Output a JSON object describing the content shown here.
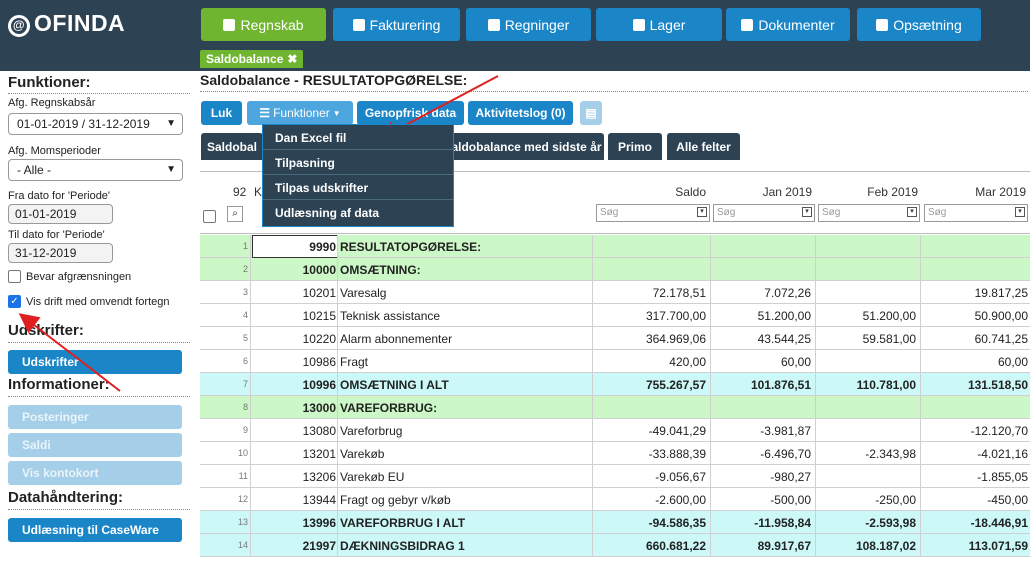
{
  "app": {
    "logo": "OFINDA"
  },
  "nav": [
    {
      "label": "Regnskab",
      "icon": "briefcase-icon",
      "active": true
    },
    {
      "label": "Fakturering",
      "icon": "document-icon"
    },
    {
      "label": "Regninger",
      "icon": "factory-icon"
    },
    {
      "label": "Lager",
      "icon": "cubes-icon"
    },
    {
      "label": "Dokumenter",
      "icon": "file-icon"
    },
    {
      "label": "Opsætning",
      "icon": "gear-icon"
    }
  ],
  "open_tab": "Saldobalance",
  "sidebar": {
    "funktioner": "Funktioner:",
    "regnskabsaar_label": "Afg. Regnskabsår",
    "regnskabsaar_value": "01-01-2019 / 31-12-2019",
    "momsperioder_label": "Afg. Momsperioder",
    "momsperioder_value": "- Alle -",
    "fra_label": "Fra dato for 'Periode'",
    "fra_value": "01-01-2019",
    "til_label": "Til dato for 'Periode'",
    "til_value": "31-12-2019",
    "bevar_label": "Bevar afgrænsningen",
    "vis_drift_label": "Vis drift med omvendt fortegn",
    "udskrifter_title": "Udskrifter:",
    "udskrifter_btn": "Udskrifter",
    "informationer_title": "Informationer:",
    "posteringer_btn": "Posteringer",
    "saldi_btn": "Saldi",
    "kontokort_btn": "Vis kontokort",
    "datahaandtering_title": "Datahåndtering:",
    "caseware_btn": "Udlæsning til CaseWare"
  },
  "main": {
    "title": "Saldobalance - RESULTATOPGØRELSE:",
    "toolbar": {
      "luk": "Luk",
      "funktioner": "Funktioner",
      "genopfrisk": "Genopfrisk data",
      "aktivitetslog": "Aktivitetslog (0)"
    },
    "dropdown": [
      "Dan Excel fil",
      "Tilpasning",
      "Tilpas udskrifter",
      "Udlæsning af data"
    ],
    "tabs": {
      "saldobalance": "Saldobal",
      "sidste_aar": "Saldobalance med sidste år",
      "primo": "Primo",
      "alle_felter": "Alle felter"
    },
    "table": {
      "count": "92",
      "k_hdr": "K",
      "headers": {
        "saldo": "Saldo",
        "jan": "Jan 2019",
        "feb": "Feb 2019",
        "mar": "Mar 2019"
      },
      "search_placeholder": "Søg",
      "rows": [
        {
          "idx": "1",
          "acct": "9990",
          "name": "RESULTATOPGØRELSE:",
          "saldo": "",
          "jan": "",
          "feb": "",
          "mar": "",
          "style": "green"
        },
        {
          "idx": "2",
          "acct": "10000",
          "name": "OMSÆTNING:",
          "saldo": "",
          "jan": "",
          "feb": "",
          "mar": "",
          "style": "green"
        },
        {
          "idx": "3",
          "acct": "10201",
          "name": "Varesalg",
          "saldo": "72.178,51",
          "jan": "7.072,26",
          "feb": "",
          "mar": "19.817,25",
          "style": ""
        },
        {
          "idx": "4",
          "acct": "10215",
          "name": "Teknisk assistance",
          "saldo": "317.700,00",
          "jan": "51.200,00",
          "feb": "51.200,00",
          "mar": "50.900,00",
          "style": ""
        },
        {
          "idx": "5",
          "acct": "10220",
          "name": "Alarm abonnementer",
          "saldo": "364.969,06",
          "jan": "43.544,25",
          "feb": "59.581,00",
          "mar": "60.741,25",
          "style": ""
        },
        {
          "idx": "6",
          "acct": "10986",
          "name": "Fragt",
          "saldo": "420,00",
          "jan": "60,00",
          "feb": "",
          "mar": "60,00",
          "style": ""
        },
        {
          "idx": "7",
          "acct": "10996",
          "name": "OMSÆTNING I ALT",
          "saldo": "755.267,57",
          "jan": "101.876,51",
          "feb": "110.781,00",
          "mar": "131.518,50",
          "style": "cyan"
        },
        {
          "idx": "8",
          "acct": "13000",
          "name": "VAREFORBRUG:",
          "saldo": "",
          "jan": "",
          "feb": "",
          "mar": "",
          "style": "green"
        },
        {
          "idx": "9",
          "acct": "13080",
          "name": "Vareforbrug",
          "saldo": "-49.041,29",
          "jan": "-3.981,87",
          "feb": "",
          "mar": "-12.120,70",
          "style": ""
        },
        {
          "idx": "10",
          "acct": "13201",
          "name": "Varekøb",
          "saldo": "-33.888,39",
          "jan": "-6.496,70",
          "feb": "-2.343,98",
          "mar": "-4.021,16",
          "style": ""
        },
        {
          "idx": "11",
          "acct": "13206",
          "name": "Varekøb EU",
          "saldo": "-9.056,67",
          "jan": "-980,27",
          "feb": "",
          "mar": "-1.855,05",
          "style": ""
        },
        {
          "idx": "12",
          "acct": "13944",
          "name": "Fragt og gebyr v/køb",
          "saldo": "-2.600,00",
          "jan": "-500,00",
          "feb": "-250,00",
          "mar": "-450,00",
          "style": ""
        },
        {
          "idx": "13",
          "acct": "13996",
          "name": "VAREFORBRUG I ALT",
          "saldo": "-94.586,35",
          "jan": "-11.958,84",
          "feb": "-2.593,98",
          "mar": "-18.446,91",
          "style": "cyan"
        },
        {
          "idx": "14",
          "acct": "21997",
          "name": "DÆKNINGSBIDRAG 1",
          "saldo": "660.681,22",
          "jan": "89.917,67",
          "feb": "108.187,02",
          "mar": "113.071,59",
          "style": "cyan"
        }
      ]
    }
  },
  "colors": {
    "navbar": "#2d4253",
    "primary": "#1a86c8",
    "active": "#6fb52f",
    "group_row": "#ccf7c6",
    "total_row": "#ccf8f8",
    "arrow": "#e02020"
  }
}
